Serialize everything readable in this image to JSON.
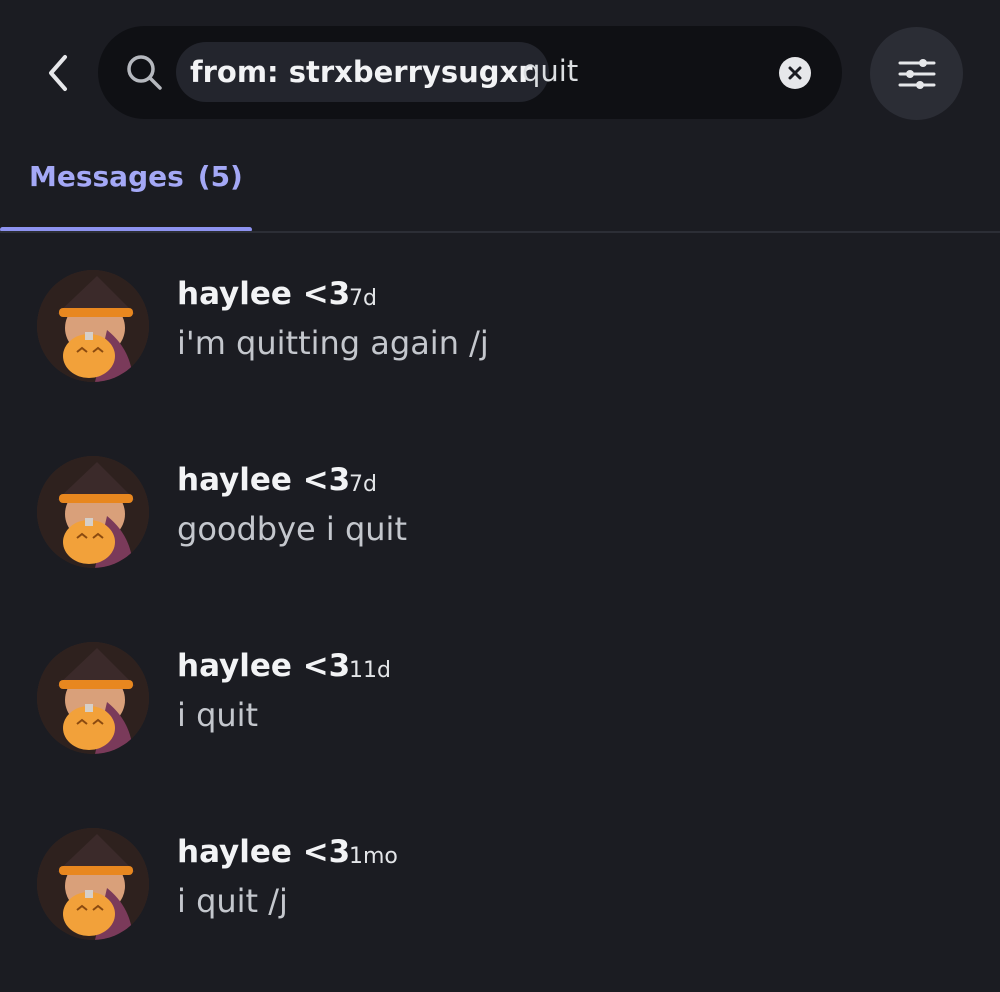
{
  "search": {
    "filter_chip": "from: strxberrysugxr",
    "query": "quit"
  },
  "tabs": {
    "messages_label": "Messages",
    "messages_count": "(5)"
  },
  "results": [
    {
      "author": "haylee <3",
      "time": "7d",
      "text": "i'm quitting again /j"
    },
    {
      "author": "haylee <3",
      "time": "7d",
      "text": "goodbye i quit"
    },
    {
      "author": "haylee <3",
      "time": "11d",
      "text": "i quit"
    },
    {
      "author": "haylee <3",
      "time": "1mo",
      "text": "i quit /j"
    }
  ],
  "colors": {
    "background": "#1b1c22",
    "search_bg": "#0f1014",
    "accent": "#a4a8f6",
    "tab_indicator": "#8d92f0"
  },
  "icons": [
    "back-chevron-icon",
    "search-icon",
    "clear-icon",
    "filter-sliders-icon"
  ]
}
